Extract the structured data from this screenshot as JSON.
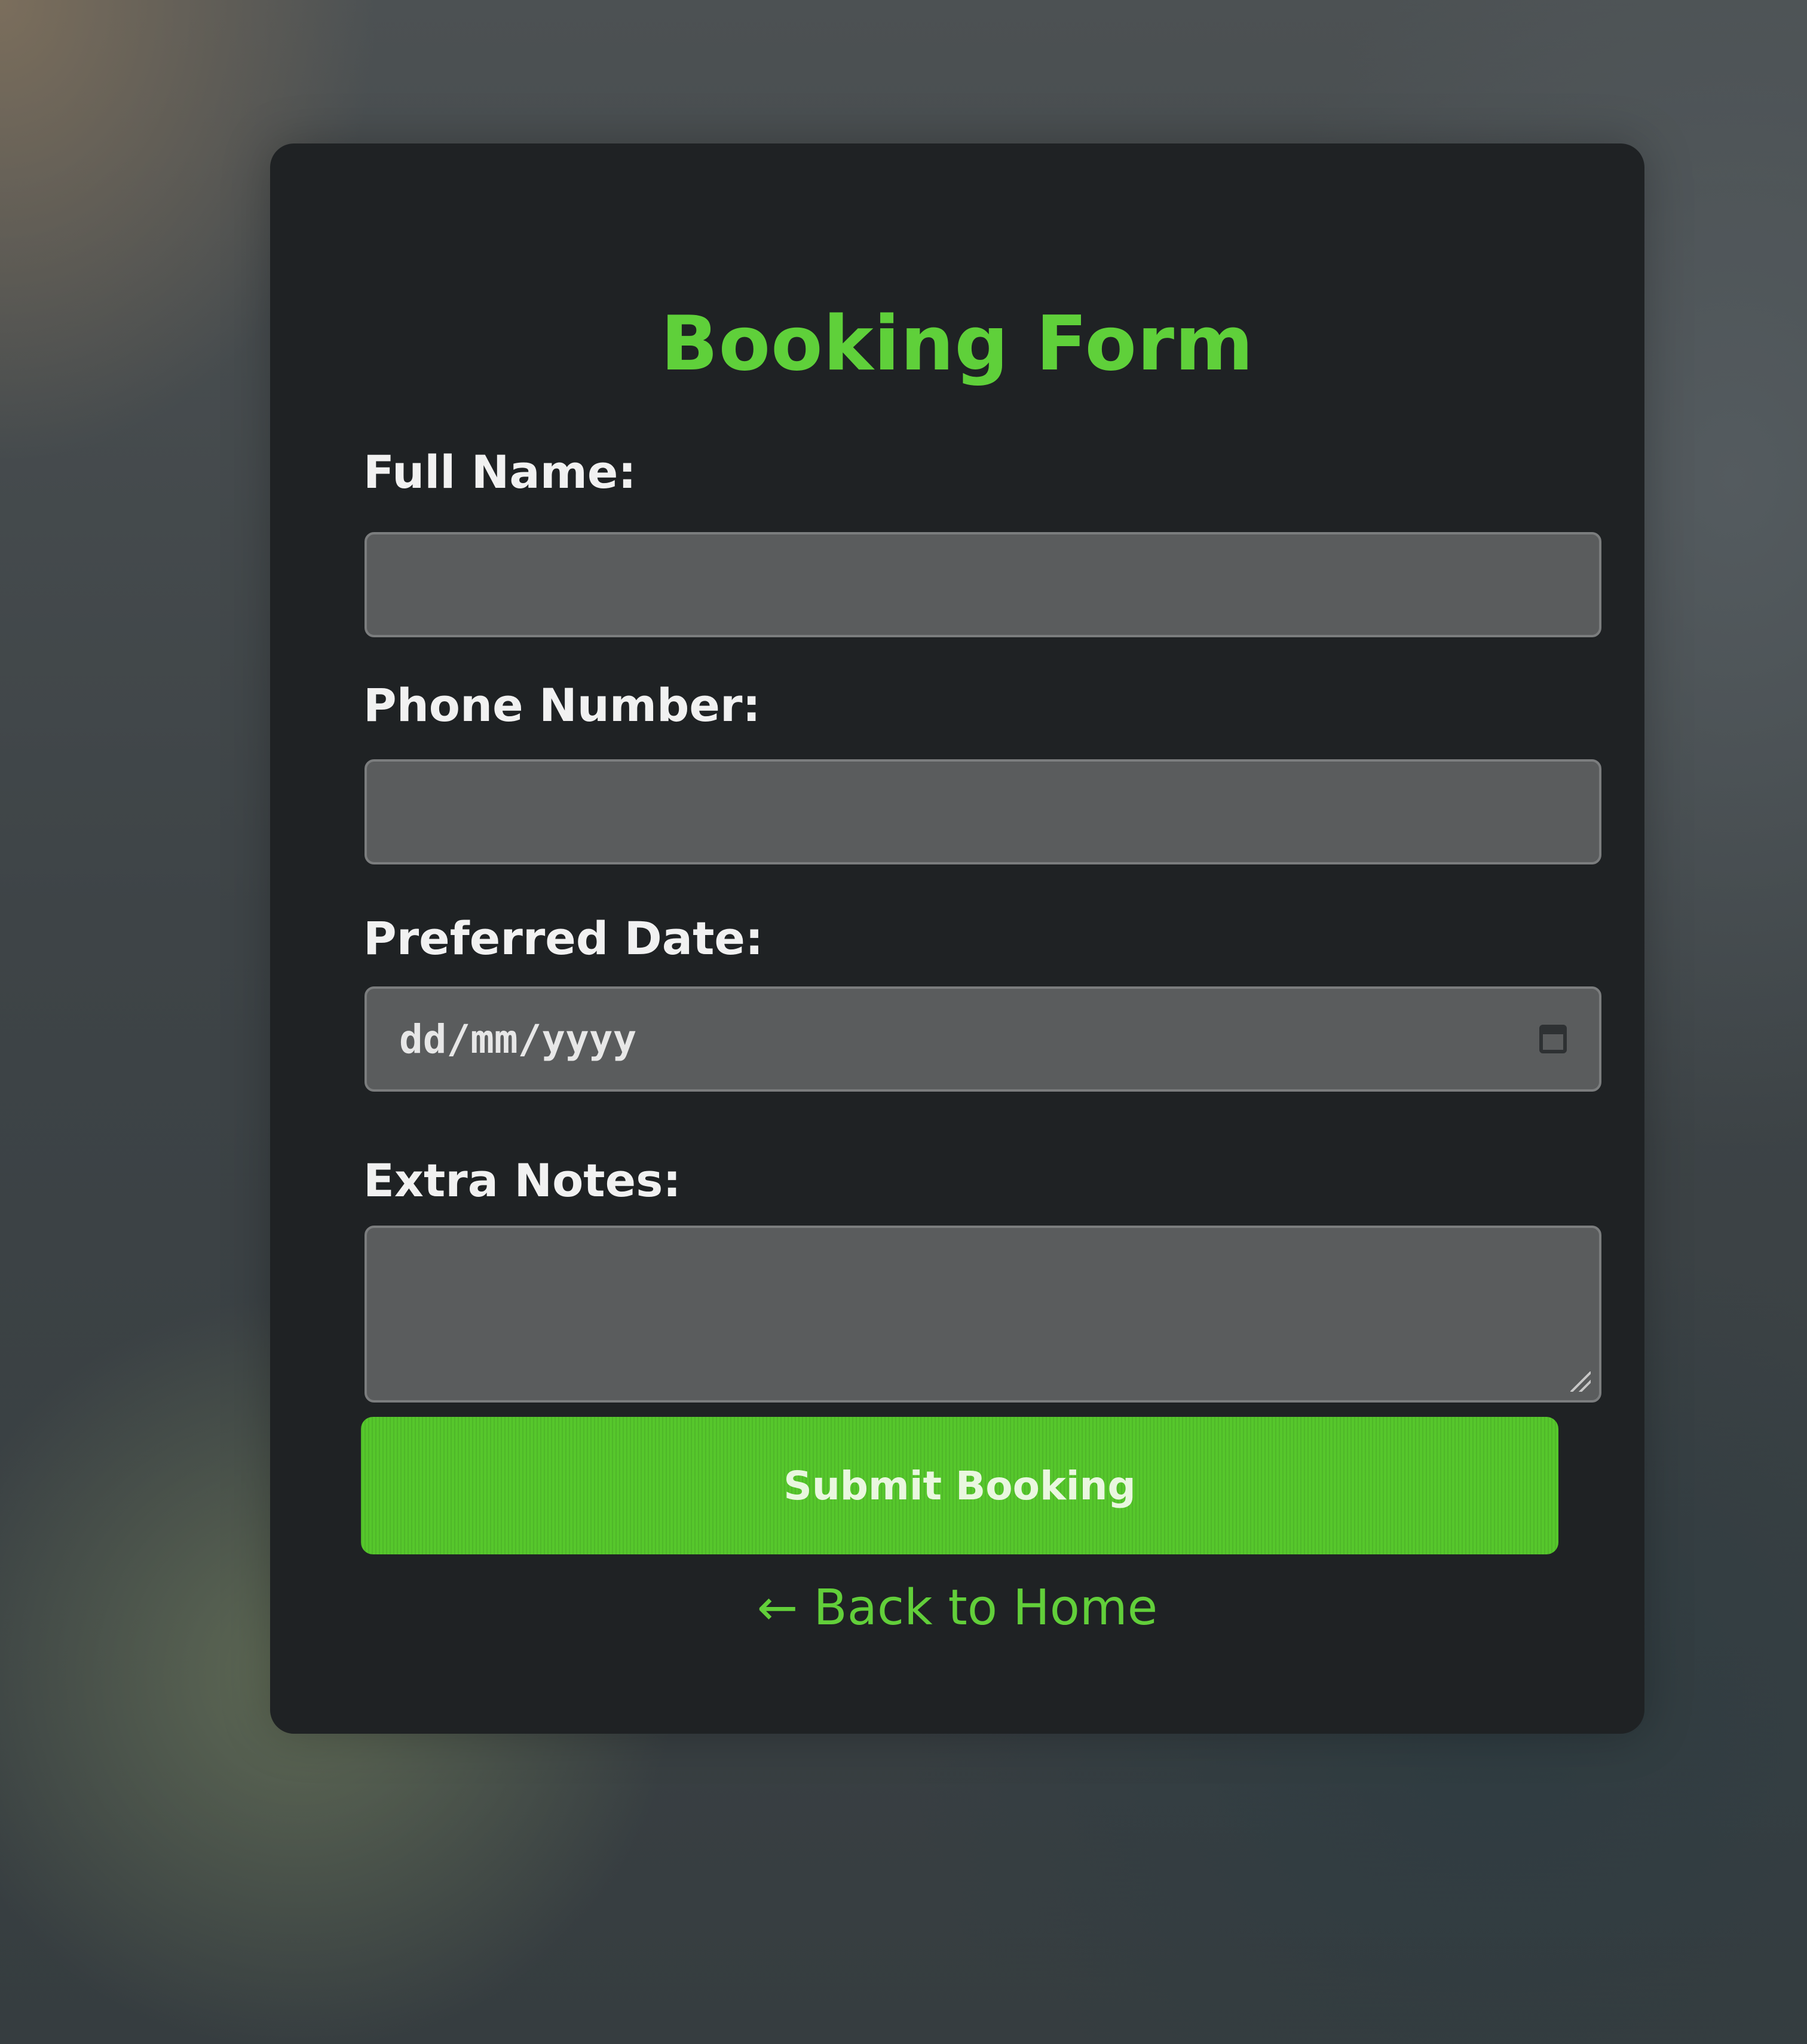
{
  "form": {
    "title": "Booking Form",
    "full_name_label": "Full Name:",
    "full_name_value": "",
    "phone_label": "Phone Number:",
    "phone_value": "",
    "date_label": "Preferred Date:",
    "date_placeholder": "dd/mm/yyyy",
    "date_icon": "calendar-icon",
    "notes_label": "Extra Notes:",
    "notes_value": "",
    "submit_label": "Submit Booking",
    "back_link": "← Back to Home"
  },
  "colors": {
    "accent": "#5fd03a",
    "card_background": "#1f2224",
    "field_background": "#5a5c5d",
    "label_text": "#f1f1f1"
  }
}
